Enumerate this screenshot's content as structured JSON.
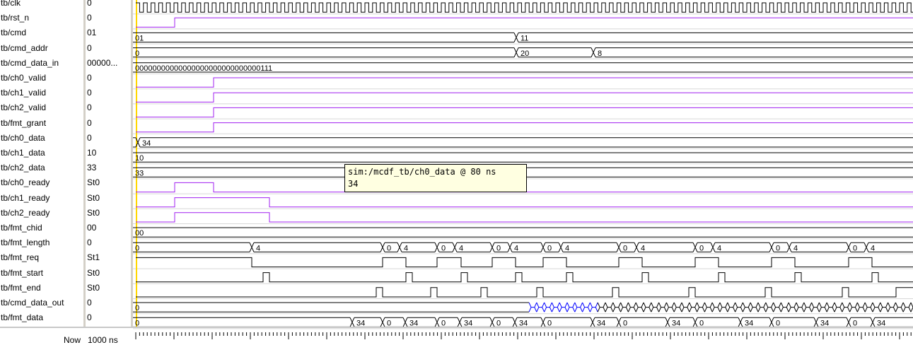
{
  "signals": [
    {
      "name": "tb/clk",
      "value": "0"
    },
    {
      "name": "tb/rst_n",
      "value": "0"
    },
    {
      "name": "tb/cmd",
      "value": "01"
    },
    {
      "name": "tb/cmd_addr",
      "value": "0"
    },
    {
      "name": "tb/cmd_data_in",
      "value": "00000..."
    },
    {
      "name": "tb/ch0_valid",
      "value": "0"
    },
    {
      "name": "tb/ch1_valid",
      "value": "0"
    },
    {
      "name": "tb/ch2_valid",
      "value": "0"
    },
    {
      "name": "tb/fmt_grant",
      "value": "0"
    },
    {
      "name": "tb/ch0_data",
      "value": "0"
    },
    {
      "name": "tb/ch1_data",
      "value": "10"
    },
    {
      "name": "tb/ch2_data",
      "value": "33"
    },
    {
      "name": "tb/ch0_ready",
      "value": "St0"
    },
    {
      "name": "tb/ch1_ready",
      "value": "St0"
    },
    {
      "name": "tb/ch2_ready",
      "value": "St0"
    },
    {
      "name": "tb/fmt_chid",
      "value": "00"
    },
    {
      "name": "tb/fmt_length",
      "value": "0"
    },
    {
      "name": "tb/fmt_req",
      "value": "St1"
    },
    {
      "name": "tb/fmt_start",
      "value": "St0"
    },
    {
      "name": "tb/fmt_end",
      "value": "St0"
    },
    {
      "name": "tb/cmd_data_out",
      "value": "0"
    },
    {
      "name": "tb/fmt_data",
      "value": "0"
    }
  ],
  "now": {
    "label": "Now",
    "value": "1000 ns"
  },
  "tooltip": {
    "title": "sim:/mcdf_tb/ch0_data @ 80 ns",
    "value": "34"
  },
  "bus_labels": {
    "cmd": [
      "01",
      "11"
    ],
    "cmd_addr": [
      "0",
      "20",
      "8"
    ],
    "cmd_data_in": [
      "00000000000000000000000000000111"
    ],
    "ch0_data": [
      "34"
    ],
    "ch1_data": [
      "10"
    ],
    "ch2_data": [
      "33"
    ],
    "fmt_chid": [
      "00"
    ],
    "fmt_length": [
      "0",
      "4",
      "0",
      "4",
      "0",
      "4",
      "0",
      "4",
      "0",
      "4",
      "0",
      "4",
      "0",
      "4",
      "0",
      "4",
      "0",
      "4"
    ],
    "cmd_data_out": [
      "0"
    ],
    "fmt_data": [
      "0",
      "34",
      "0",
      "34",
      "0",
      "34",
      "0",
      "34",
      "0",
      "34",
      "0",
      "34",
      "0",
      "34",
      "0",
      "34",
      "0",
      "34"
    ]
  },
  "colors": {
    "wave": "#000000",
    "highlight": "#a020f0",
    "cursor": "#ffd700",
    "bus_active": "#0000ff",
    "tooltip_bg": "#ffffe1"
  }
}
